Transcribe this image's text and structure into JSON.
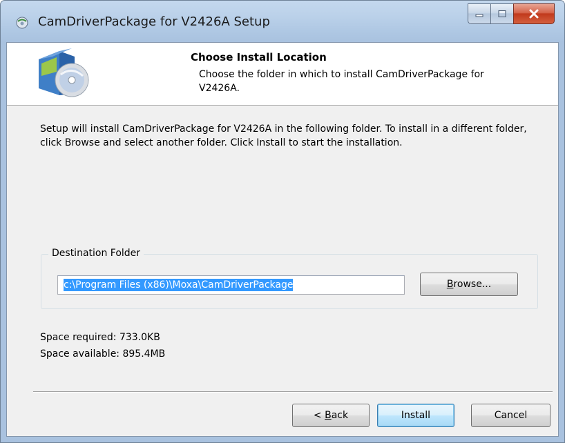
{
  "window": {
    "title": "CamDriverPackage for V2426A Setup",
    "minimize_icon": "minimize-icon",
    "maximize_icon": "maximize-icon",
    "close_icon": "close-icon"
  },
  "header": {
    "title": "Choose Install Location",
    "subtitle": "Choose the folder in which to install CamDriverPackage for V2426A.",
    "icon": "software-package-icon"
  },
  "body": {
    "intro": "Setup will install CamDriverPackage for V2426A in the following folder. To install in a different folder, click Browse and select another folder. Click Install to start the installation."
  },
  "destination": {
    "group_label": "Destination Folder",
    "path": "c:\\Program Files (x86)\\Moxa\\CamDriverPackage",
    "browse_label_accel": "B",
    "browse_label_rest": "rowse..."
  },
  "space": {
    "required": "Space required: 733.0KB",
    "available": "Space available: 895.4MB"
  },
  "buttons": {
    "back_prefix": "< ",
    "back_accel": "B",
    "back_rest": "ack",
    "install": "Install",
    "cancel": "Cancel"
  },
  "colors": {
    "selection": "#3399ff",
    "frame": "#a9c2df",
    "close_button": "#c1391c"
  }
}
